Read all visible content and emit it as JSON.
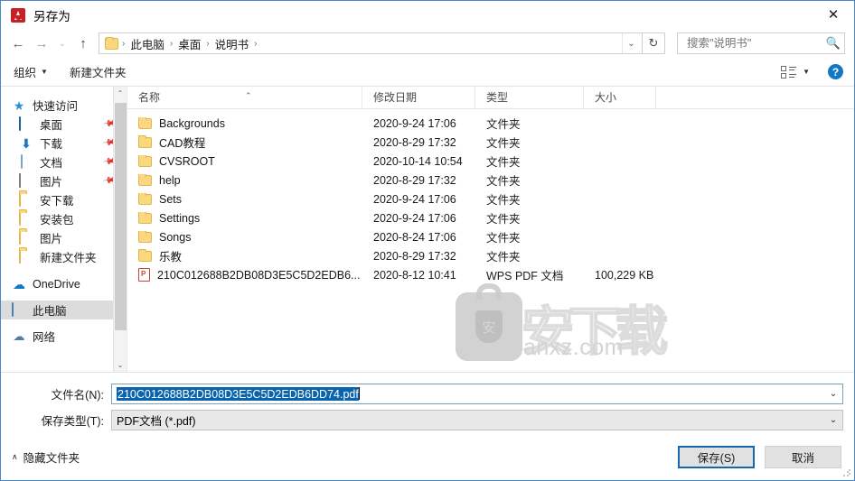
{
  "window": {
    "title": "另存为",
    "app_icon": "acrobat-icon",
    "close_label": "✕"
  },
  "nav": {
    "back": "←",
    "forward": "→",
    "recent": "⌄",
    "up": "↑",
    "refresh": "↻",
    "address_chevron": "⌄",
    "breadcrumbs": [
      "此电脑",
      "桌面",
      "说明书"
    ],
    "separator": "›"
  },
  "search": {
    "placeholder": "搜索\"说明书\"",
    "value": "",
    "icon": "search-icon"
  },
  "toolbar": {
    "organize_label": "组织",
    "organize_caret": "▼",
    "new_folder_label": "新建文件夹",
    "view_caret": "▼",
    "help_label": "?"
  },
  "sidebar": {
    "items": [
      {
        "label": "快速访问",
        "icon": "star-icon",
        "pinned": false,
        "selected": false,
        "root": true
      },
      {
        "label": "桌面",
        "icon": "desktop-icon",
        "pinned": true,
        "selected": false,
        "root": false
      },
      {
        "label": "下载",
        "icon": "download-icon",
        "pinned": true,
        "selected": false,
        "root": false
      },
      {
        "label": "文档",
        "icon": "documents-icon",
        "pinned": true,
        "selected": false,
        "root": false
      },
      {
        "label": "图片",
        "icon": "pictures-icon",
        "pinned": true,
        "selected": false,
        "root": false
      },
      {
        "label": "安下载",
        "icon": "folder-icon",
        "pinned": false,
        "selected": false,
        "root": false
      },
      {
        "label": "安装包",
        "icon": "folder-icon",
        "pinned": false,
        "selected": false,
        "root": false
      },
      {
        "label": "图片",
        "icon": "folder-icon",
        "pinned": false,
        "selected": false,
        "root": false
      },
      {
        "label": "新建文件夹",
        "icon": "folder-icon",
        "pinned": false,
        "selected": false,
        "root": false
      },
      {
        "label": "OneDrive",
        "icon": "cloud-icon",
        "pinned": false,
        "selected": false,
        "root": true
      },
      {
        "label": "此电脑",
        "icon": "this-pc-icon",
        "pinned": false,
        "selected": true,
        "root": true
      },
      {
        "label": "网络",
        "icon": "network-icon",
        "pinned": false,
        "selected": false,
        "root": true
      }
    ],
    "scroll_up": "⌃",
    "scroll_down": "⌄"
  },
  "filelist": {
    "columns": [
      "名称",
      "修改日期",
      "类型",
      "大小"
    ],
    "sort_indicator": "⌃",
    "rows": [
      {
        "name": "Backgrounds",
        "date": "2020-9-24 17:06",
        "type": "文件夹",
        "size": "",
        "icon": "folder-icon"
      },
      {
        "name": "CAD教程",
        "date": "2020-8-29 17:32",
        "type": "文件夹",
        "size": "",
        "icon": "folder-icon"
      },
      {
        "name": "CVSROOT",
        "date": "2020-10-14 10:54",
        "type": "文件夹",
        "size": "",
        "icon": "folder-icon"
      },
      {
        "name": "help",
        "date": "2020-8-29 17:32",
        "type": "文件夹",
        "size": "",
        "icon": "folder-icon"
      },
      {
        "name": "Sets",
        "date": "2020-9-24 17:06",
        "type": "文件夹",
        "size": "",
        "icon": "folder-icon"
      },
      {
        "name": "Settings",
        "date": "2020-9-24 17:06",
        "type": "文件夹",
        "size": "",
        "icon": "folder-icon"
      },
      {
        "name": "Songs",
        "date": "2020-8-24 17:06",
        "type": "文件夹",
        "size": "",
        "icon": "folder-icon"
      },
      {
        "name": "乐教",
        "date": "2020-8-29 17:32",
        "type": "文件夹",
        "size": "",
        "icon": "folder-icon"
      },
      {
        "name": "210C012688B2DB08D3E5C5D2EDB6...",
        "date": "2020-8-12 10:41",
        "type": "WPS PDF 文档",
        "size": "100,229 KB",
        "icon": "pdf-icon"
      }
    ]
  },
  "watermark": {
    "logo_char": "安",
    "outline_text": "安下载",
    "url": "anxz.com"
  },
  "form": {
    "filename_label": "文件名(N):",
    "filename_value": "210C012688B2DB08D3E5C5D2EDB6DD74.pdf",
    "filetype_label": "保存类型(T):",
    "filetype_value": "PDF文档 (*.pdf)",
    "caret": "⌄"
  },
  "footer": {
    "hide_folders_caret": "∧",
    "hide_folders_label": "隐藏文件夹",
    "save_label": "保存(S)",
    "cancel_label": "取消"
  },
  "colors": {
    "accent": "#1767ad",
    "selection": "#0a64ad",
    "folder": "#fbd77e",
    "pdf": "#c9423b"
  }
}
